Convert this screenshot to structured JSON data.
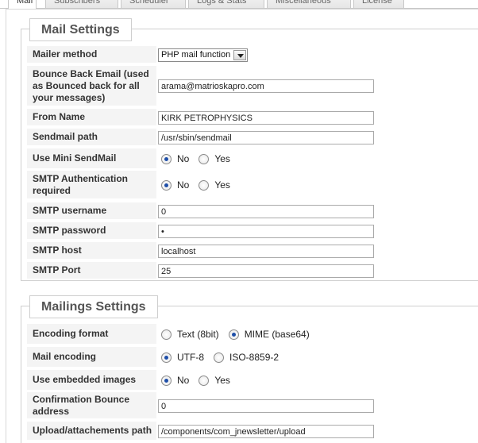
{
  "tabs": [
    "Mail",
    "Subscribers",
    "Scheduler",
    "Logs & Stats",
    "Miscellaneous",
    "License"
  ],
  "mail_settings": {
    "title": "Mail Settings",
    "mailer_method": {
      "label": "Mailer method",
      "value": "PHP mail function"
    },
    "bounce_email": {
      "label": "Bounce Back Email (used as Bounced back for all your messages)",
      "value": "arama@matrioskapro.com"
    },
    "from_name": {
      "label": "From Name",
      "value": "KIRK PETROPHYSICS"
    },
    "sendmail_path": {
      "label": "Sendmail path",
      "value": "/usr/sbin/sendmail"
    },
    "mini_sendmail": {
      "label": "Use Mini SendMail",
      "opt1": "No",
      "opt2": "Yes",
      "selected": "No"
    },
    "smtp_auth": {
      "label": "SMTP Authentication required",
      "opt1": "No",
      "opt2": "Yes",
      "selected": "No"
    },
    "smtp_username": {
      "label": "SMTP username",
      "value": "0"
    },
    "smtp_password": {
      "label": "SMTP password",
      "value": "•"
    },
    "smtp_host": {
      "label": "SMTP host",
      "value": "localhost"
    },
    "smtp_port": {
      "label": "SMTP Port",
      "value": "25"
    }
  },
  "mailings_settings": {
    "title": "Mailings Settings",
    "encoding_format": {
      "label": "Encoding format",
      "opt1": "Text (8bit)",
      "opt2": "MIME (base64)",
      "selected": "MIME (base64)"
    },
    "mail_encoding": {
      "label": "Mail encoding",
      "opt1": "UTF-8",
      "opt2": "ISO-8859-2",
      "selected": "UTF-8"
    },
    "embedded_images": {
      "label": "Use embedded images",
      "opt1": "No",
      "opt2": "Yes",
      "selected": "No"
    },
    "confirmation_bounce": {
      "label": "Confirmation Bounce address",
      "value": "0"
    },
    "upload_path": {
      "label": "Upload/attachements path",
      "value": "/components/com_jnewsletter/upload"
    }
  }
}
